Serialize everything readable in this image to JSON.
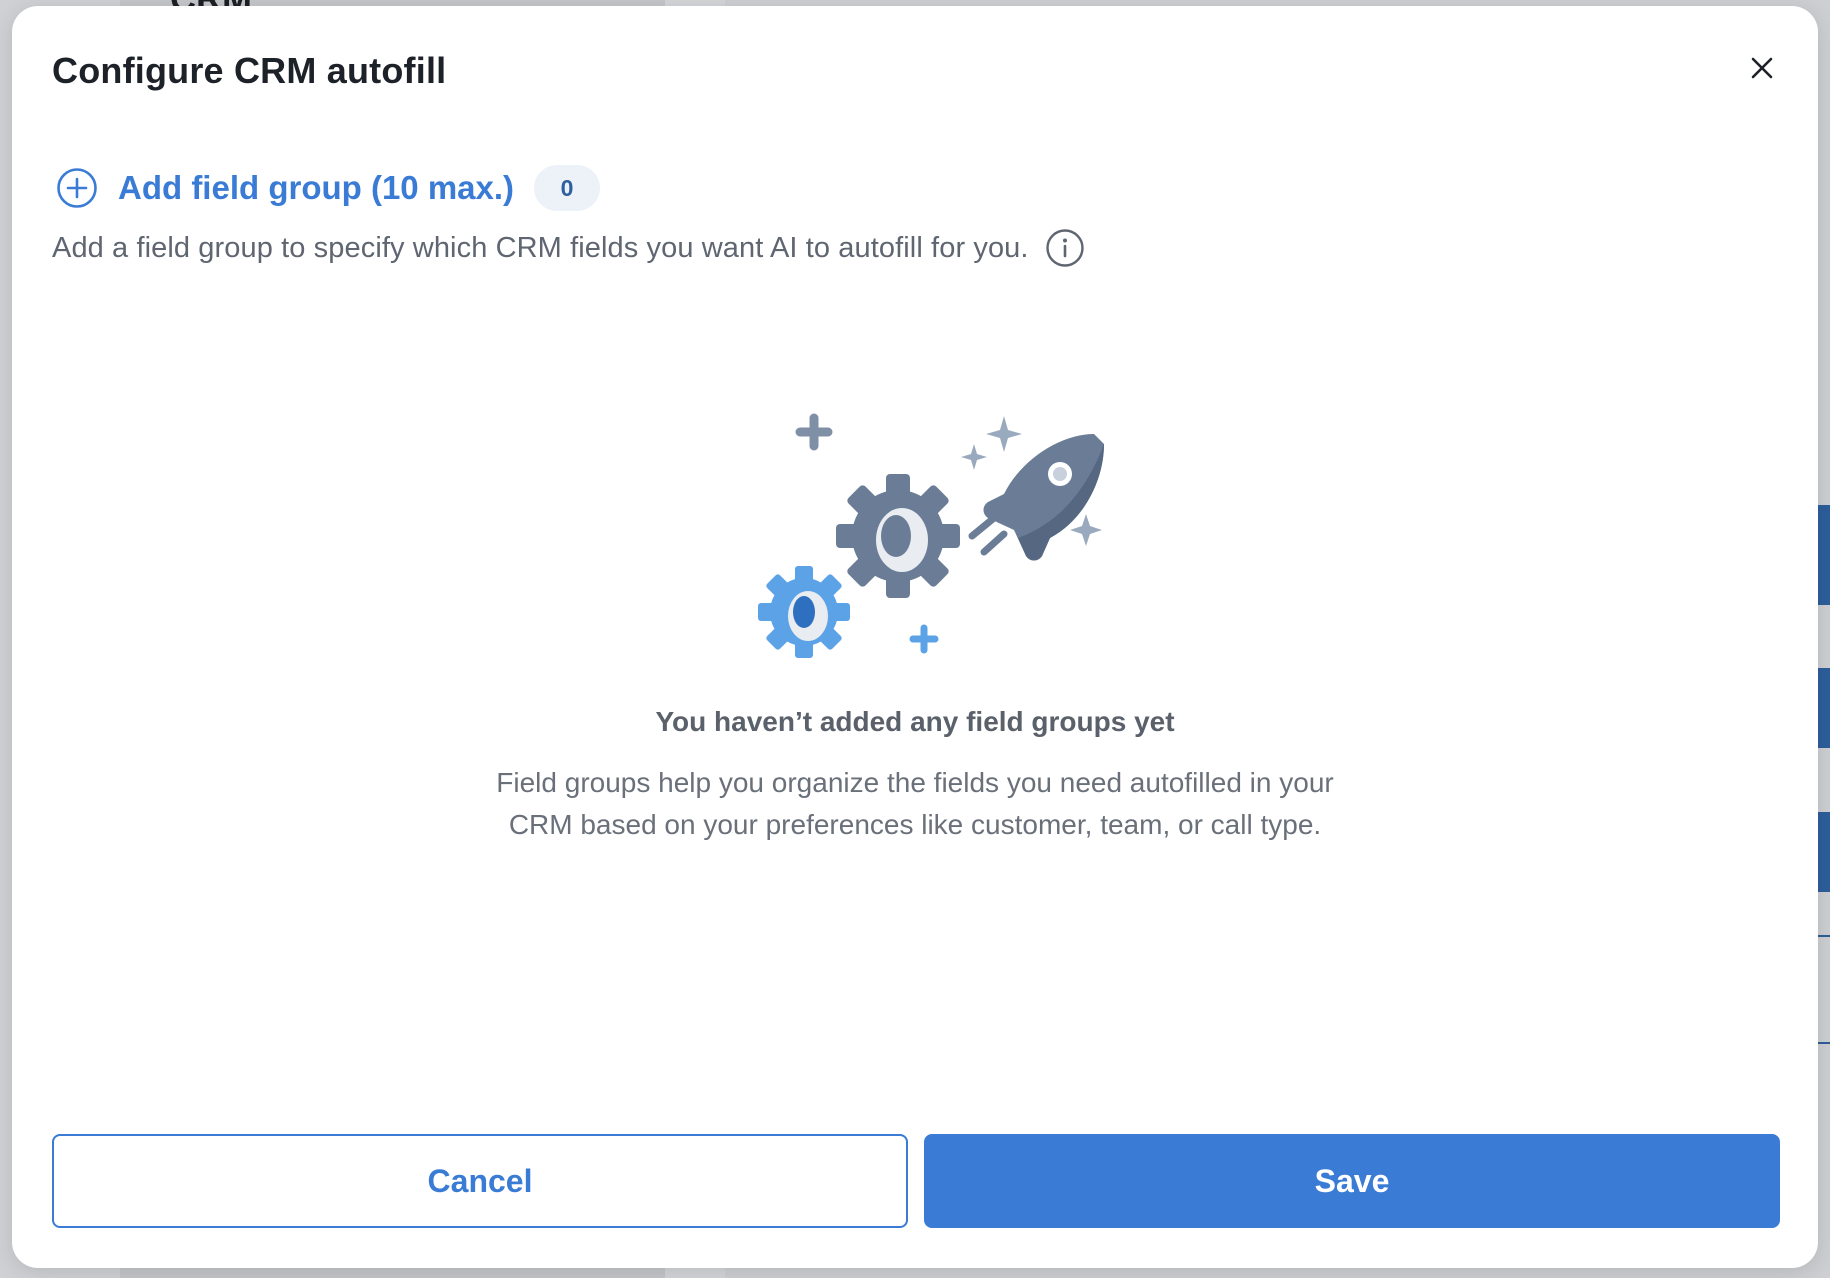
{
  "background": {
    "title": "CRM"
  },
  "modal": {
    "title": "Configure CRM autofill",
    "close_icon": "close-icon",
    "add_group": {
      "label": "Add field group (10 max.)",
      "icon": "plus-circle-icon",
      "count": "0"
    },
    "description": "Add a field group to specify which CRM fields you want AI to autofill for you.",
    "info_icon": "info-icon",
    "empty_state": {
      "illustration": "rocket-gears-illustration",
      "title": "You haven’t added any field groups yet",
      "body_line1": "Field groups help you organize the fields you need autofilled in your",
      "body_line2": "CRM based on your preferences like customer, team, or call type."
    },
    "cancel_label": "Cancel",
    "save_label": "Save"
  },
  "colors": {
    "accent": "#3a7bd5",
    "badge_bg": "#edf2f8",
    "text_muted": "#5f6671"
  }
}
